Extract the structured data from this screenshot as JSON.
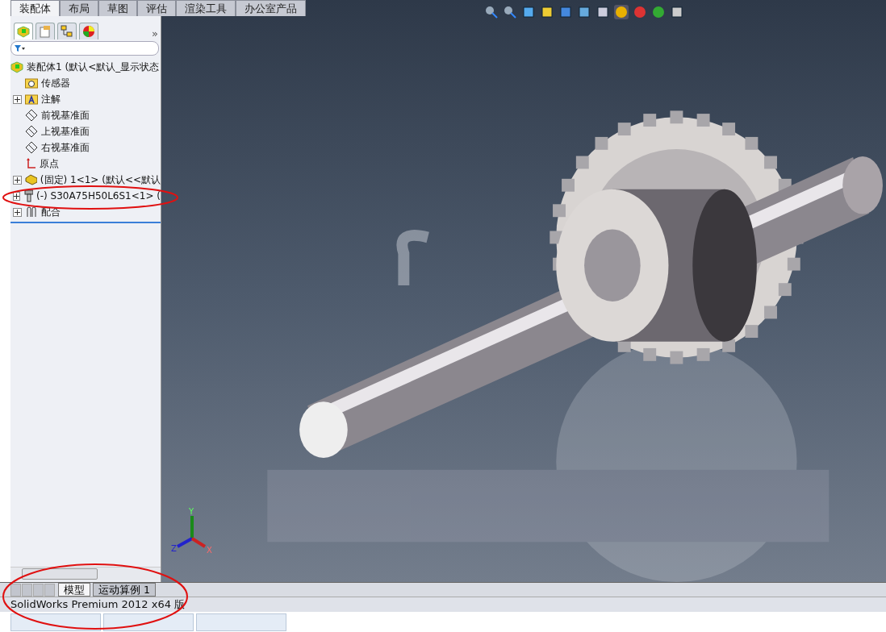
{
  "ribbon_tabs": [
    {
      "label": "装配体",
      "selected": true
    },
    {
      "label": "布局",
      "selected": false
    },
    {
      "label": "草图",
      "selected": false
    },
    {
      "label": "评估",
      "selected": false
    },
    {
      "label": "渲染工具",
      "selected": false
    },
    {
      "label": "办公室产品",
      "selected": false
    }
  ],
  "panel_tabs": [
    {
      "kind": "tree",
      "selected": true
    },
    {
      "kind": "property",
      "selected": false
    },
    {
      "kind": "config",
      "selected": false
    },
    {
      "kind": "display",
      "selected": false
    }
  ],
  "panel_more": "»",
  "tree": {
    "label": "装配体1  (默认<默认_显示状态",
    "children": [
      {
        "kind": "sensor",
        "label": "传感器",
        "expandable": false
      },
      {
        "kind": "annotation",
        "label": "注解",
        "expandable": true
      },
      {
        "kind": "plane",
        "label": "前视基准面",
        "expandable": false
      },
      {
        "kind": "plane",
        "label": "上视基准面",
        "expandable": false
      },
      {
        "kind": "plane",
        "label": "右视基准面",
        "expandable": false
      },
      {
        "kind": "origin",
        "label": "原点",
        "expandable": false
      },
      {
        "kind": "part",
        "label": "(固定) 1<1> (默认<<默认",
        "expandable": true
      },
      {
        "kind": "bolt",
        "label": "(-) S30A75H50L6S1<1> (",
        "expandable": true
      },
      {
        "kind": "mate",
        "label": "配合",
        "expandable": true
      }
    ]
  },
  "triad": {
    "x": "X",
    "y": "Y",
    "z": "Z"
  },
  "bottom_tabs": [
    {
      "label": "模型",
      "selected": true
    },
    {
      "label": "运动算例 1",
      "selected": false
    }
  ],
  "status_bar": "SolidWorks Premium 2012 x64 版"
}
